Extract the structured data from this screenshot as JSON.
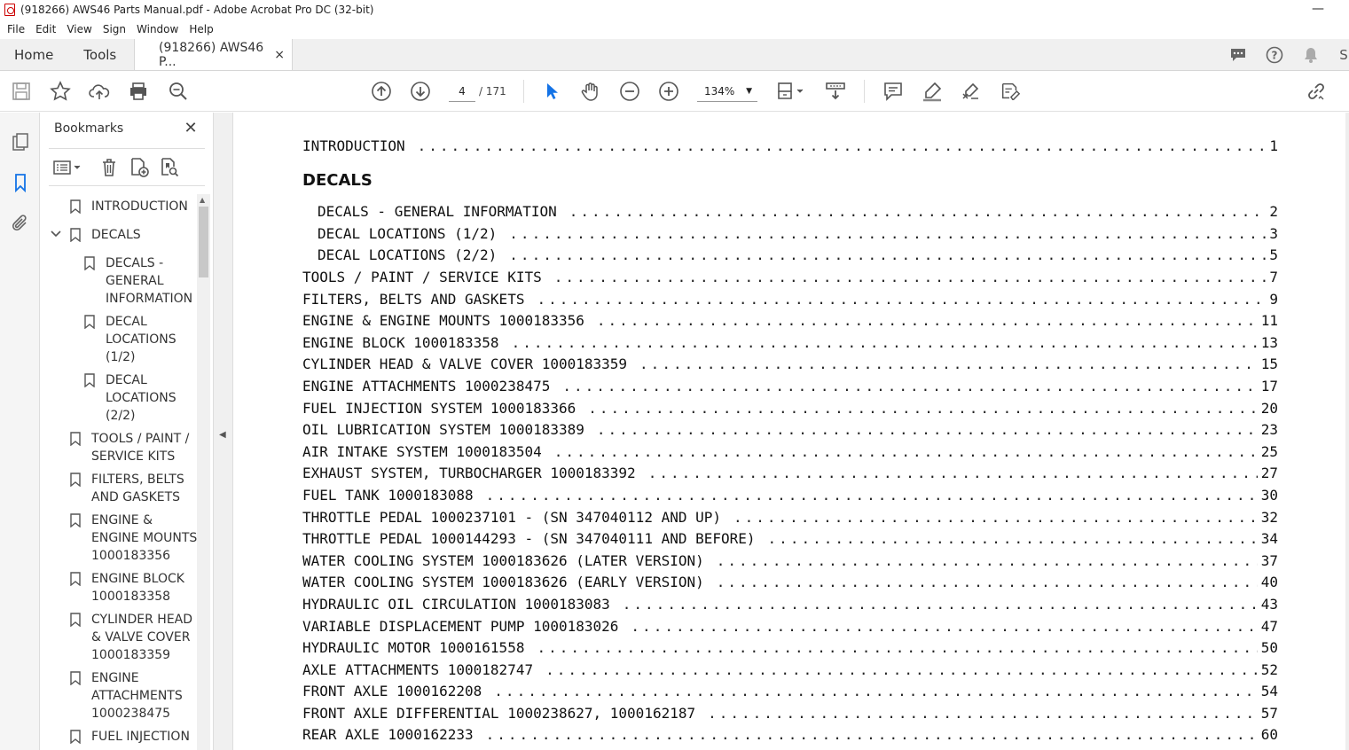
{
  "window": {
    "title": "(918266) AWS46 Parts Manual.pdf - Adobe Acrobat Pro DC (32-bit)"
  },
  "menu": [
    "File",
    "Edit",
    "View",
    "Sign",
    "Window",
    "Help"
  ],
  "tabs": {
    "home": "Home",
    "tools": "Tools",
    "document": "(918266) AWS46 P...",
    "close": "×"
  },
  "toolbar": {
    "page_current": "4",
    "page_total": "/ 171",
    "zoom": "134%"
  },
  "bookmarks": {
    "header": "Bookmarks",
    "items": [
      {
        "label": "INTRODUCTION",
        "lines": [
          "INTRODUCTION"
        ]
      },
      {
        "label": "DECALS",
        "lines": [
          "DECALS"
        ]
      },
      {
        "label": "DECALS - GENERAL INFORMATION",
        "lines": [
          "DECALS -",
          "GENERAL",
          "INFORMATION"
        ]
      },
      {
        "label": "DECAL LOCATIONS (1/2)",
        "lines": [
          "DECAL",
          "LOCATIONS",
          "(1/2)"
        ]
      },
      {
        "label": "DECAL LOCATIONS (2/2)",
        "lines": [
          "DECAL",
          "LOCATIONS",
          "(2/2)"
        ]
      },
      {
        "label": "TOOLS / PAINT / SERVICE KITS",
        "lines": [
          "TOOLS / PAINT /",
          "SERVICE KITS"
        ]
      },
      {
        "label": "FILTERS, BELTS AND GASKETS",
        "lines": [
          "FILTERS, BELTS",
          "AND GASKETS"
        ]
      },
      {
        "label": "ENGINE & ENGINE MOUNTS 1000183356",
        "lines": [
          "ENGINE &",
          "ENGINE MOUNTS",
          "1000183356"
        ]
      },
      {
        "label": "ENGINE BLOCK 1000183358",
        "lines": [
          "ENGINE BLOCK",
          "1000183358"
        ]
      },
      {
        "label": "CYLINDER HEAD & VALVE COVER 1000183359",
        "lines": [
          "CYLINDER HEAD",
          "& VALVE COVER",
          "1000183359"
        ]
      },
      {
        "label": "ENGINE ATTACHMENTS 1000238475",
        "lines": [
          "ENGINE",
          "ATTACHMENTS",
          "1000238475"
        ]
      },
      {
        "label": "FUEL INJECTION",
        "lines": [
          "FUEL INJECTION"
        ]
      }
    ]
  },
  "toc": {
    "heading_decals": "DECALS",
    "rows": [
      {
        "title": "INTRODUCTION",
        "page": "1"
      },
      {
        "title": "DECALS - GENERAL INFORMATION",
        "page": "2"
      },
      {
        "title": "DECAL LOCATIONS (1/2)",
        "page": "3"
      },
      {
        "title": "DECAL LOCATIONS (2/2)",
        "page": "5"
      },
      {
        "title": "TOOLS / PAINT / SERVICE KITS",
        "page": "7"
      },
      {
        "title": "FILTERS, BELTS AND GASKETS",
        "page": "9"
      },
      {
        "title": "ENGINE & ENGINE MOUNTS 1000183356",
        "page": "11"
      },
      {
        "title": "ENGINE BLOCK 1000183358",
        "page": "13"
      },
      {
        "title": "CYLINDER HEAD & VALVE COVER 1000183359",
        "page": "15"
      },
      {
        "title": "ENGINE ATTACHMENTS 1000238475",
        "page": "17"
      },
      {
        "title": "FUEL INJECTION SYSTEM 1000183366",
        "page": "20"
      },
      {
        "title": "OIL LUBRICATION SYSTEM 1000183389",
        "page": "23"
      },
      {
        "title": "AIR INTAKE SYSTEM 1000183504",
        "page": "25"
      },
      {
        "title": "EXHAUST SYSTEM, TURBOCHARGER 1000183392",
        "page": "27"
      },
      {
        "title": "FUEL TANK 1000183088",
        "page": "30"
      },
      {
        "title": "THROTTLE PEDAL 1000237101 - (SN 347040112 AND UP)",
        "page": "32"
      },
      {
        "title": "THROTTLE PEDAL 1000144293 - (SN 347040111 AND BEFORE)",
        "page": "34"
      },
      {
        "title": "WATER COOLING SYSTEM 1000183626 (LATER VERSION)",
        "page": "37"
      },
      {
        "title": "WATER COOLING SYSTEM 1000183626 (EARLY VERSION)",
        "page": "40"
      },
      {
        "title": "HYDRAULIC OIL CIRCULATION 1000183083",
        "page": "43"
      },
      {
        "title": "VARIABLE DISPLACEMENT PUMP 1000183026",
        "page": "47"
      },
      {
        "title": "HYDRAULIC MOTOR 1000161558",
        "page": "50"
      },
      {
        "title": "AXLE ATTACHMENTS 1000182747",
        "page": "52"
      },
      {
        "title": "FRONT AXLE 1000162208",
        "page": "54"
      },
      {
        "title": "FRONT AXLE DIFFERENTIAL 1000238627, 1000162187",
        "page": "57"
      },
      {
        "title": "REAR AXLE 1000162233",
        "page": "60"
      }
    ]
  },
  "colors": {
    "accent": "#1473e6",
    "icon": "#555555"
  }
}
